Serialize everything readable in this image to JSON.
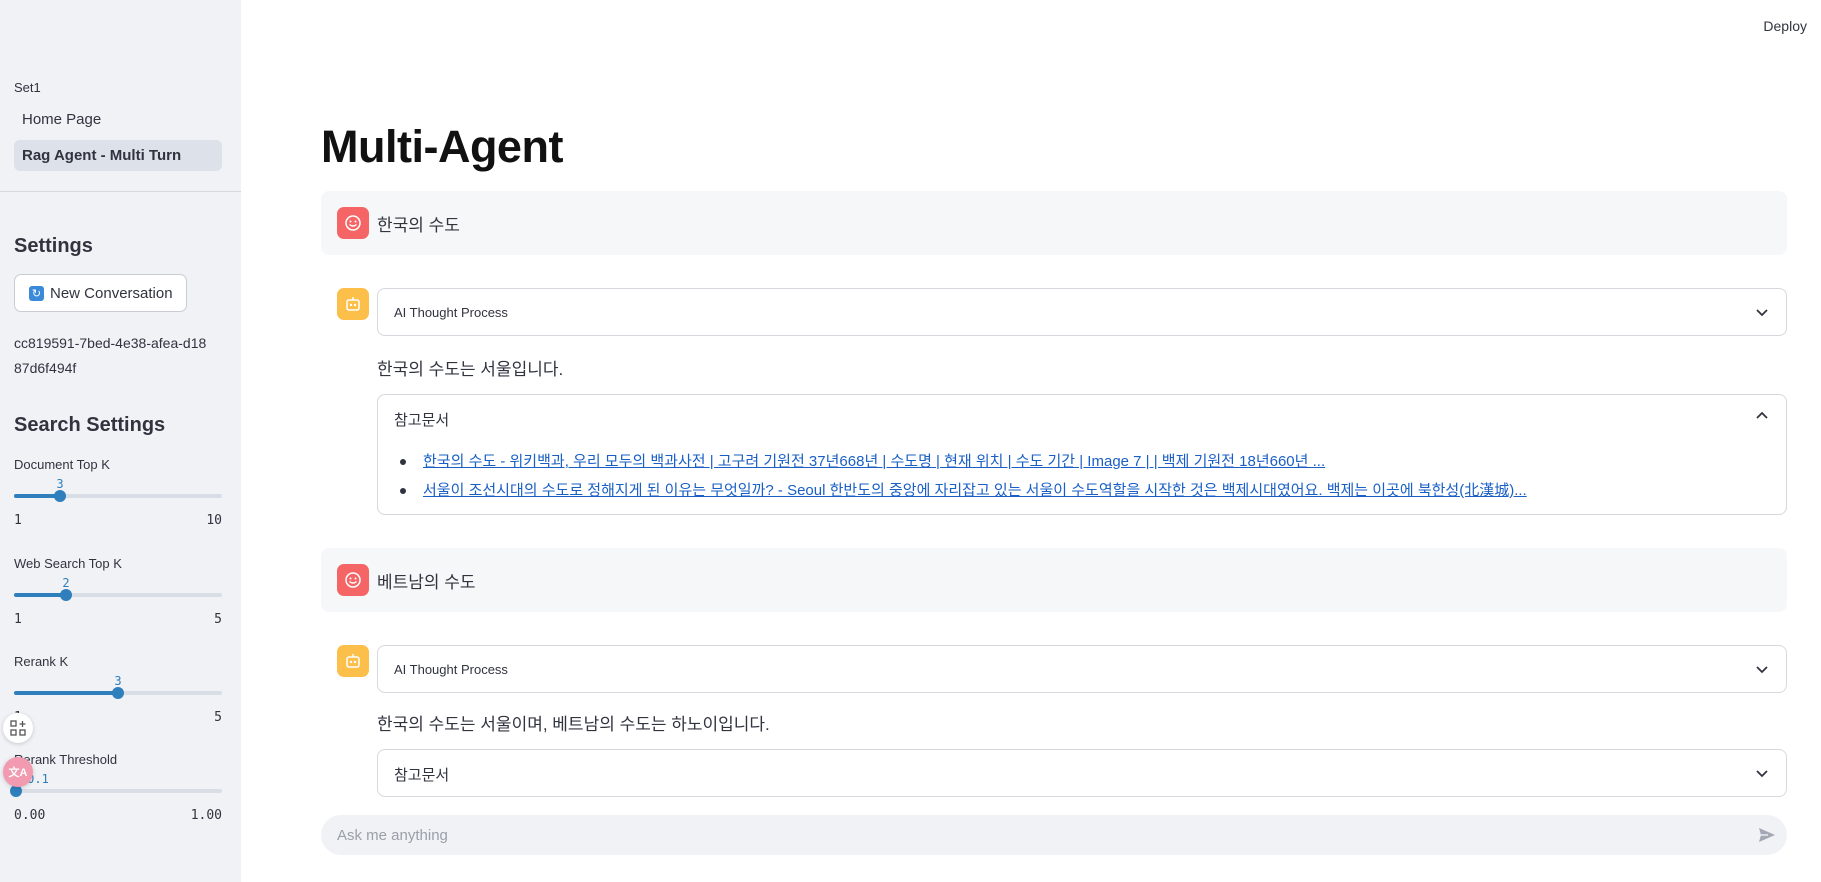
{
  "header": {
    "deploy_label": "Deploy"
  },
  "sidebar": {
    "nav_section": "Set1",
    "nav_items": [
      {
        "label": "Home Page",
        "active": false
      },
      {
        "label": "Rag Agent - Multi Turn",
        "active": true
      }
    ],
    "settings_heading": "Settings",
    "new_conversation_label": "New Conversation",
    "conversation_id": "cc819591-7bed-4e38-afea-d1887d6f494f",
    "search_settings_heading": "Search Settings",
    "sliders": [
      {
        "label": "Document Top K",
        "value": "3",
        "min": "1",
        "max": "10",
        "fraction": 0.2222
      },
      {
        "label": "Web Search Top K",
        "value": "2",
        "min": "1",
        "max": "5",
        "fraction": 0.25
      },
      {
        "label": "Rerank K",
        "value": "3",
        "min": "1",
        "max": "5",
        "fraction": 0.5
      },
      {
        "label": "Rerank Threshold",
        "value": "0.1",
        "min": "0.00",
        "max": "1.00",
        "fraction": 0.0
      }
    ]
  },
  "main": {
    "title": "Multi-Agent",
    "messages": [
      {
        "user": "한국의 수도",
        "thought_label": "AI Thought Process",
        "answer": "한국의 수도는 서울입니다.",
        "refs_label": "참고문서",
        "refs": [
          "한국의 수도 - 위키백과, 우리 모두의 백과사전 | 고구려 기원전 37년668년 | 수도명 | 현재 위치 | 수도 기간 | Image 7 | | 백제 기원전 18년660년 ...",
          "서울이 조선시대의 수도로 정해지게 된 이유는 무엇일까? - Seoul 한반도의 중앙에 자리잡고 있는 서울이 수도역할을 시작한 것은 백제시대였어요. 백제는 이곳에 북한성(北漢城)..."
        ]
      },
      {
        "user": "베트남의 수도",
        "thought_label": "AI Thought Process",
        "answer": "한국의 수도는 서울이며, 베트남의 수도는 하노이입니다.",
        "refs_label": "참고문서"
      }
    ]
  },
  "chat_input": {
    "placeholder": "Ask me anything"
  },
  "icons": {
    "user_avatar": "smile-face-icon",
    "bot_avatar": "robot-icon",
    "chevron_down": "chevron-down-icon",
    "chevron_up": "chevron-up-icon",
    "send": "send-icon",
    "new_conversation": "refresh-icon"
  },
  "colors": {
    "accent": "#2f7fbd",
    "link": "#1a5fc6",
    "user_avatar": "#f56565",
    "bot_avatar": "#fbbf4a",
    "sidebar_bg": "#f0f2f6"
  }
}
